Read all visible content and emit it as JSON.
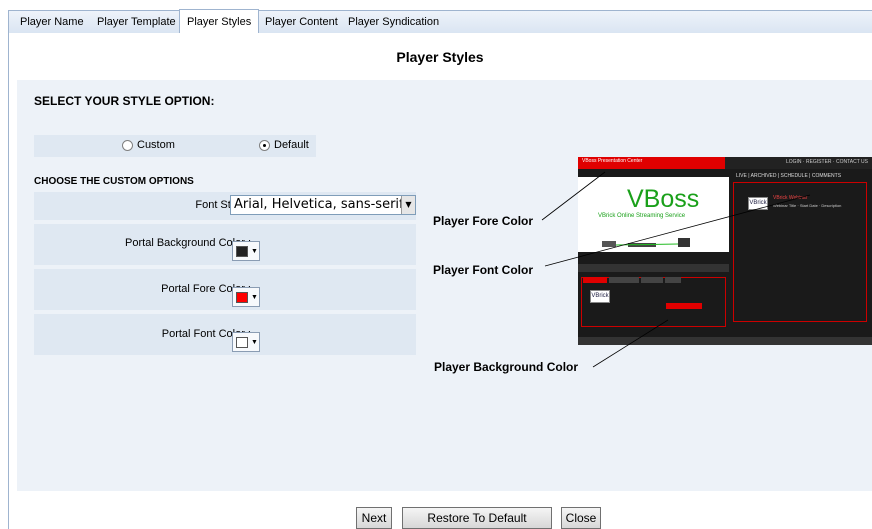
{
  "tabs": [
    {
      "label": "Player Name"
    },
    {
      "label": "Player Template"
    },
    {
      "label": "Player Styles"
    },
    {
      "label": "Player Content"
    },
    {
      "label": "Player Syndication"
    }
  ],
  "active_tab": "Player Styles",
  "page_title": "Player Styles",
  "style_section": {
    "heading": "SELECT YOUR STYLE OPTION:",
    "options": [
      {
        "label": "Custom",
        "selected": false
      },
      {
        "label": "Default",
        "selected": true
      }
    ]
  },
  "custom_options": {
    "heading": "CHOOSE THE CUSTOM OPTIONS",
    "font_style": {
      "label": "Font Style :",
      "value": "Arial, Helvetica, sans-serif"
    },
    "portal_background_color": {
      "label": "Portal Background Color :",
      "color": "#222222"
    },
    "portal_fore_color": {
      "label": "Portal Fore Color :",
      "color": "#ff0000"
    },
    "portal_font_color": {
      "label": "Portal Font Color :",
      "color": "#ffffff"
    }
  },
  "preview": {
    "brand": "VBoss",
    "tagline": "VBrick Online Streaming Service",
    "header_text": "VBoss Presentation Center",
    "nav_text": "LIVE | ARCHIVED | SCHEDULE | COMMENTS",
    "logo_text": "VBrick"
  },
  "annotations": {
    "fore": "Player Fore Color",
    "font": "Player Font Color",
    "background": "Player Background Color"
  },
  "buttons": {
    "next": "Next",
    "restore": "Restore To Default",
    "close": "Close"
  }
}
